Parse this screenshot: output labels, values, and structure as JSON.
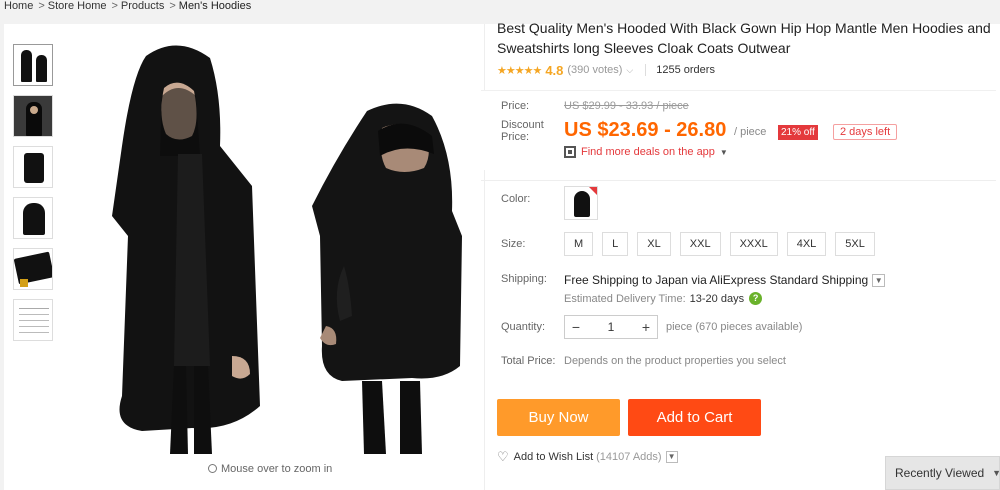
{
  "breadcrumb": [
    "Home",
    "Store Home",
    "Products",
    "Men's Hoodies"
  ],
  "breadcrumb_sep": ">",
  "product": {
    "title": "Best Quality Men's Hooded With Black Gown Hip Hop Mantle Men Hoodies and Sweatshirts long Sleeves Cloak Coats Outwear",
    "stars": "★★★★★",
    "rating": "4.8",
    "votes": "(390 votes)",
    "orders": "1255 orders"
  },
  "price": {
    "label": "Price:",
    "original": "US $29.99 - 33.93 / piece",
    "discount_label": "Discount Price:",
    "discount": "US $23.69 - 26.80",
    "per_piece": "/ piece",
    "off_badge": "21% off",
    "days_left": "2 days left",
    "deals_link": "Find more deals on the app"
  },
  "options": {
    "color_label": "Color:",
    "size_label": "Size:",
    "sizes": [
      "M",
      "L",
      "XL",
      "XXL",
      "XXXL",
      "4XL",
      "5XL"
    ]
  },
  "shipping": {
    "label": "Shipping:",
    "main": "Free Shipping to Japan via AliExpress Standard Shipping",
    "est_label": "Estimated Delivery Time:",
    "est_days": "13-20 days"
  },
  "quantity": {
    "label": "Quantity:",
    "minus": "−",
    "value": "1",
    "plus": "+",
    "note": "piece (670 pieces available)"
  },
  "total": {
    "label": "Total Price:",
    "note": "Depends on the product properties you select"
  },
  "actions": {
    "buy_now": "Buy Now",
    "add_to_cart": "Add to Cart",
    "wishlist": "Add to Wish List",
    "wishlist_count": "(14107 Adds)"
  },
  "image": {
    "zoom_hint": "Mouse over to zoom in"
  },
  "recently_viewed": "Recently Viewed",
  "colors": {
    "accent_orange": "#ff6600",
    "buy_now": "#ff9a2a",
    "add_to_cart": "#ff4a14",
    "badge_red": "#e4393c",
    "star": "#f5a623"
  },
  "icons": [
    "qr-code-icon",
    "chevron-down-icon",
    "help-icon",
    "heart-icon",
    "magnifier-icon"
  ]
}
